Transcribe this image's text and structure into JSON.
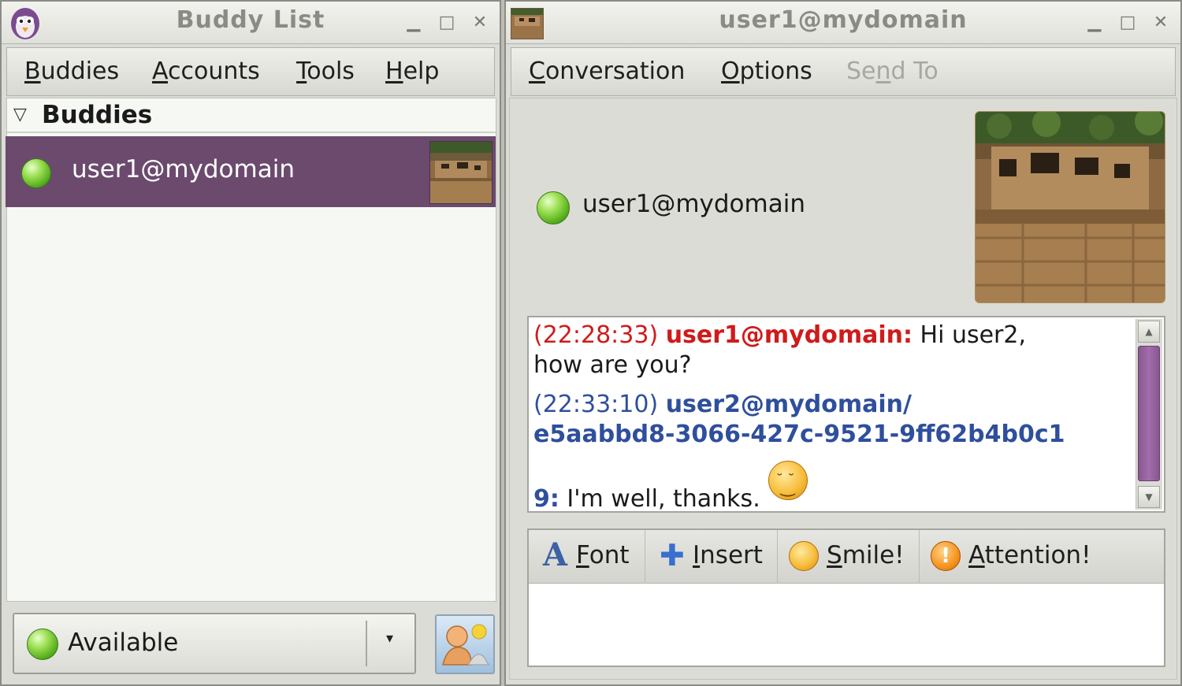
{
  "buddy_window": {
    "title": "Buddy List",
    "controls": {
      "minimize": "▁",
      "maximize": "□",
      "close": "✕"
    },
    "menu": [
      {
        "label": "Buddies",
        "mnemonic": "B",
        "rest": "uddies"
      },
      {
        "label": "Accounts",
        "mnemonic": "A",
        "rest": "ccounts"
      },
      {
        "label": "Tools",
        "mnemonic": "T",
        "rest": "ools"
      },
      {
        "label": "Help",
        "mnemonic": "H",
        "rest": "elp"
      }
    ],
    "group": {
      "name": "Buddies",
      "expander": "▽"
    },
    "buddies": [
      {
        "name": "user1@mydomain",
        "status": "available"
      }
    ],
    "status_selector": {
      "value": "Available",
      "arrow": "▾"
    }
  },
  "conversation_window": {
    "title": "user1@mydomain",
    "controls": {
      "minimize": "▁",
      "maximize": "□",
      "close": "✕"
    },
    "menu": [
      {
        "label": "Conversation",
        "mnemonic": "C",
        "rest": "onversation",
        "enabled": true
      },
      {
        "label": "Options",
        "mnemonic": "O",
        "rest": "ptions",
        "enabled": true
      },
      {
        "label": "Send To",
        "mnemonic": "",
        "pre": "Se",
        "u": "n",
        "post": "d To",
        "enabled": false
      }
    ],
    "contact": {
      "name": "user1@mydomain",
      "status": "available"
    },
    "messages": [
      {
        "time": "(22:28:33)",
        "sender": "user1@mydomain:",
        "text_line1": "Hi user2,",
        "text_line2": "how are you?"
      },
      {
        "time": "(22:33:10)",
        "sender_line1": "user2@mydomain/",
        "sender_line2": "e5aabbd8-3066-427c-9521-9ff62b4b0c1",
        "sender_line3": "9:",
        "text": "I'm well, thanks."
      }
    ],
    "format_toolbar": {
      "font": {
        "label": "Font",
        "mnemonic": "F",
        "rest": "ont"
      },
      "insert": {
        "label": "Insert",
        "mnemonic": "I",
        "rest": "nsert"
      },
      "smile": {
        "label": "Smile!",
        "mnemonic": "S",
        "rest": "mile!"
      },
      "attention": {
        "label": "Attention!",
        "mnemonic": "A",
        "rest": "ttention!"
      }
    }
  },
  "colors": {
    "selection": "#6b4a6e",
    "incoming_nick": "#cf1b1b",
    "outgoing_nick": "#2f4f9c",
    "available": "#4ea818"
  }
}
